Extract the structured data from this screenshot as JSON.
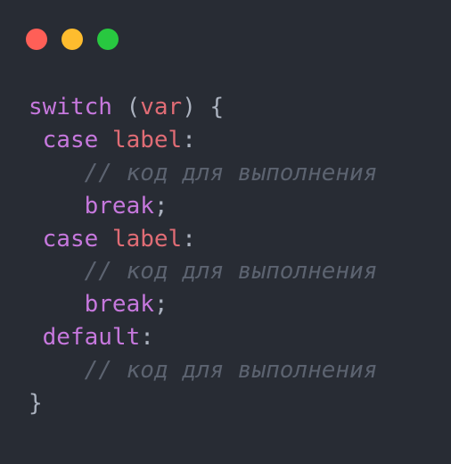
{
  "window": {
    "buttons": {
      "close_color": "#ff5f57",
      "minimize_color": "#febc2e",
      "maximize_color": "#28c840"
    }
  },
  "code": {
    "line1": {
      "keyword": "switch",
      "open": " (",
      "variable": "var",
      "close": ") {"
    },
    "case1": {
      "keyword": "case",
      "label": "label",
      "colon": ":",
      "comment": "// код для выполнения",
      "break_kw": "break",
      "semicolon": ";"
    },
    "case2": {
      "keyword": "case",
      "label": "label",
      "colon": ":",
      "comment": "// код для выполнения",
      "break_kw": "break",
      "semicolon": ";"
    },
    "default_block": {
      "keyword": "default",
      "colon": ":",
      "comment": "// код для выполнения"
    },
    "closing_brace": "}"
  },
  "colors": {
    "background": "#282c34",
    "keyword": "#c678dd",
    "variable": "#e06c75",
    "punctuation": "#abb2bf",
    "comment": "#5c6370"
  }
}
